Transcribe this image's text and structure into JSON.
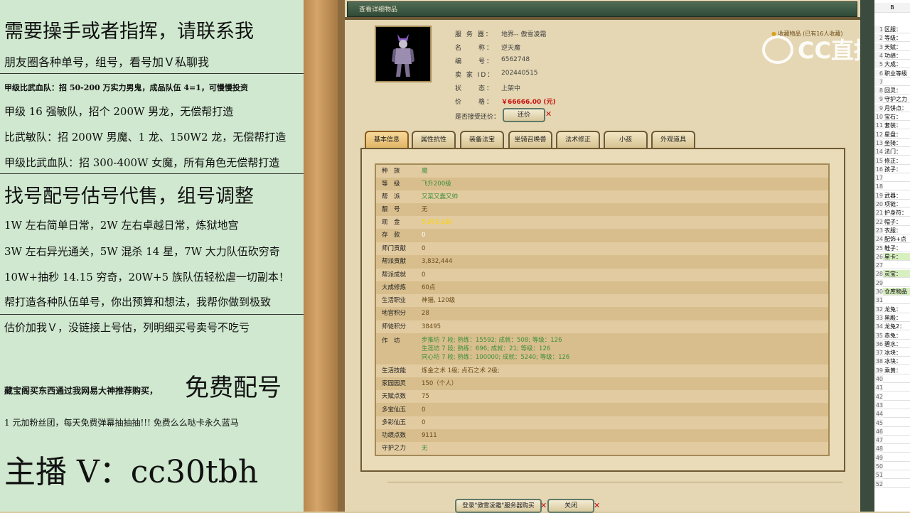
{
  "overlay": {
    "lines": [
      "需要操手或者指挥，请联系我",
      "朋友圈各种单号，组号，看号加Ｖ私聊我",
      "甲级比武血队：招 50-200 万实力男鬼，成品队伍 4=1，可慢慢投资",
      "甲级 16 强敏队，招个 200W 男龙，无偿帮打造",
      "比武敏队：招 200W 男魔、1 龙、150W2 龙，无偿帮打造",
      "甲级比武血队：招 300-400W 女魔，所有角色无偿帮打造",
      "找号配号估号代售，组号调整",
      "1W 左右简单日常，2W 左右卓越日常，炼狱地宫",
      "3W 左右异光通关，5W 混杀 14 星，7W 大力队伍砍穷奇",
      "10W+抽秒 14.15 穷奇，20W+5 族队伍轻松虐一切副本！",
      "帮打造各种队伍单号，你出预算和想法，我帮你做到极致",
      "估价加我Ｖ，没链接上号估，列明细买号卖号不吃亏",
      "藏宝阁买东西通过我网易大神推荐购买，",
      "免费配号",
      "1 元加粉丝团，每天免费弹幕抽抽抽!!! 免费么么哒卡永久蓝马",
      "主播 V：cc30tbh"
    ]
  },
  "window": {
    "title": "查看详细物品"
  },
  "char_info": {
    "server_label": "服 务 器：",
    "server_value": "地界-- 傲雪凌霜",
    "name_label": "名　　称：",
    "name_value": "逆天魔",
    "id_label": "编　　号：",
    "id_value": "6562748",
    "seller_label": "卖 家 ID：",
    "seller_value": "202440515",
    "status_label": "状　　态：",
    "status_value": "上架中",
    "price_label": "价　　格：",
    "price_value": "￥66666.00 (元)",
    "bargain_label": "是否接受还价：",
    "bargain_button": "还价",
    "fav_text": "收藏物品 (已有16人收藏)"
  },
  "tabs": [
    "基本信息",
    "属性抗性",
    "装备法宝",
    "坐骑召唤兽",
    "法术修正",
    "小孩",
    "外观道具"
  ],
  "rows": [
    {
      "label": "种　族",
      "value": "魔"
    },
    {
      "label": "等　级",
      "value": "飞升200级"
    },
    {
      "label": "帮　派",
      "value": "又菜又蠢又帅"
    },
    {
      "label": "靓　号",
      "value": "无"
    },
    {
      "label": "现　金",
      "value": "5,073,330"
    },
    {
      "label": "存　款",
      "value": "0"
    },
    {
      "label": "师门贡献",
      "value": "0"
    },
    {
      "label": "帮派贡献",
      "value": "3,832,444"
    },
    {
      "label": "帮派成就",
      "value": "0"
    },
    {
      "label": "大成修炼",
      "value": "60点"
    },
    {
      "label": "生活职业",
      "value": "神猫, 120级"
    },
    {
      "label": "地宫积分",
      "value": "28"
    },
    {
      "label": "师徒积分",
      "value": "38495"
    },
    {
      "label": "作　坊",
      "value": "步推坊 7 段; 熟练：15592; 成就：508; 等级：126\n生莲坊 7 段; 熟练：696; 成就：21; 等级：126\n同心坊 7 段; 熟练：100000; 成就：5240; 等级：126"
    },
    {
      "label": "生活技能",
      "value": "炼金之术 1级; 点石之术 2级;"
    },
    {
      "label": "家园园灵",
      "value": "150（个人）"
    },
    {
      "label": "天赋点数",
      "value": "75"
    },
    {
      "label": "多宝仙玉",
      "value": "0"
    },
    {
      "label": "多彩仙玉",
      "value": "0"
    },
    {
      "label": "功绩点数",
      "value": "9111"
    },
    {
      "label": "守护之力",
      "value": "无"
    }
  ],
  "buttons": {
    "buy": "登录\"傲雪凌霜\"服务器购买",
    "close": "关闭"
  },
  "watermark": "CC直播",
  "sheet": {
    "header": "B",
    "cells": [
      {
        "n": "1",
        "t": "区服："
      },
      {
        "n": "2",
        "t": "等级："
      },
      {
        "n": "3",
        "t": "天赋："
      },
      {
        "n": "4",
        "t": "功绩："
      },
      {
        "n": "5",
        "t": "大成："
      },
      {
        "n": "6",
        "t": "职业等级"
      },
      {
        "n": "7",
        "t": ""
      },
      {
        "n": "8",
        "t": "回灵："
      },
      {
        "n": "9",
        "t": "守护之力"
      },
      {
        "n": "9",
        "t": "月饼点："
      },
      {
        "n": "10",
        "t": "宝石："
      },
      {
        "n": "11",
        "t": "套装："
      },
      {
        "n": "12",
        "t": "星盘："
      },
      {
        "n": "13",
        "t": "坐骑："
      },
      {
        "n": "14",
        "t": "法门："
      },
      {
        "n": "15",
        "t": "修正："
      },
      {
        "n": "16",
        "t": "孩子："
      },
      {
        "n": "17",
        "t": ""
      },
      {
        "n": "18",
        "t": ""
      },
      {
        "n": "19",
        "t": "武器："
      },
      {
        "n": "20",
        "t": "项链："
      },
      {
        "n": "21",
        "t": "护身符："
      },
      {
        "n": "22",
        "t": "帽子："
      },
      {
        "n": "23",
        "t": "衣服："
      },
      {
        "n": "24",
        "t": "配饰+点"
      },
      {
        "n": "25",
        "t": "鞋子："
      },
      {
        "n": "26",
        "t": "星卡："
      },
      {
        "n": "27",
        "t": ""
      },
      {
        "n": "28",
        "t": "灵宝："
      },
      {
        "n": "29",
        "t": ""
      },
      {
        "n": "30",
        "t": "仓库物品"
      },
      {
        "n": "31",
        "t": ""
      },
      {
        "n": "32",
        "t": "龙兔："
      },
      {
        "n": "33",
        "t": "黑殿："
      },
      {
        "n": "34",
        "t": "龙兔2："
      },
      {
        "n": "35",
        "t": "赤兔："
      },
      {
        "n": "36",
        "t": "碧水："
      },
      {
        "n": "37",
        "t": "冰块："
      },
      {
        "n": "38",
        "t": "冰块："
      },
      {
        "n": "39",
        "t": "乘黄："
      },
      {
        "n": "40",
        "t": ""
      },
      {
        "n": "41",
        "t": ""
      },
      {
        "n": "42",
        "t": ""
      },
      {
        "n": "43",
        "t": ""
      },
      {
        "n": "44",
        "t": ""
      },
      {
        "n": "45",
        "t": ""
      },
      {
        "n": "46",
        "t": ""
      },
      {
        "n": "47",
        "t": ""
      },
      {
        "n": "48",
        "t": ""
      },
      {
        "n": "49",
        "t": ""
      },
      {
        "n": "50",
        "t": ""
      },
      {
        "n": "51",
        "t": ""
      },
      {
        "n": "52",
        "t": ""
      }
    ]
  }
}
